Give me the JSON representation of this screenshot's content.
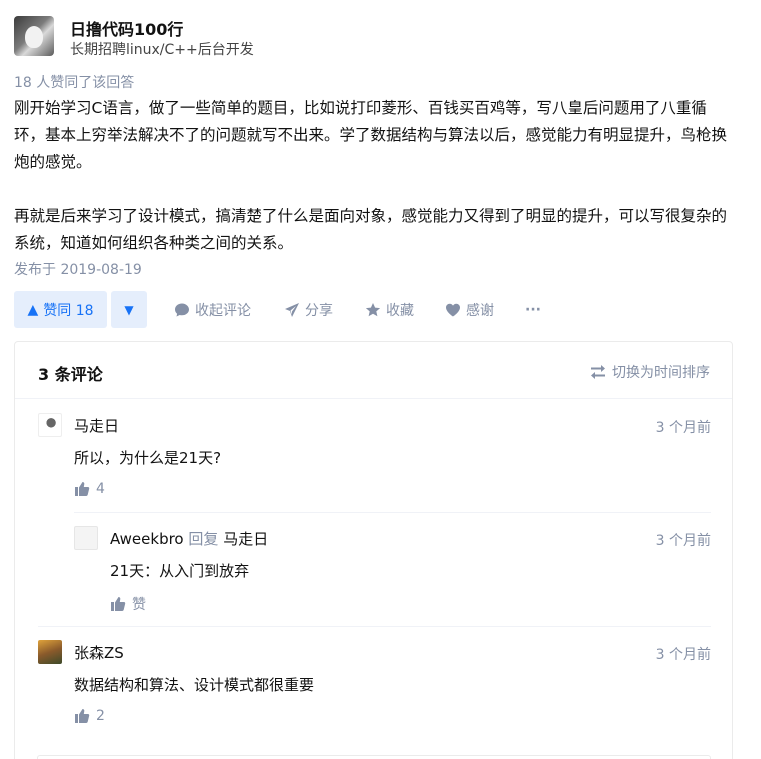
{
  "author": {
    "name": "日撸代码100行",
    "bio": "长期招聘linux/C++后台开发"
  },
  "upvote_info": "18 人赞同了该回答",
  "content": {
    "paragraphs": [
      "刚开始学习C语言，做了一些简单的题目，比如说打印菱形、百钱买百鸡等，写八皇后问题用了八重循环，基本上穷举法解决不了的问题就写不出来。学了数据结构与算法以后，感觉能力有明显提升，鸟枪换炮的感觉。",
      "再就是后来学习了设计模式，搞清楚了什么是面向对象，感觉能力又得到了明显的提升，可以写很复杂的系统，知道如何组织各种类之间的关系。"
    ]
  },
  "pub_date": "发布于 2019-08-19",
  "actions": {
    "vote_up_label": "赞同 18",
    "collapse_comments": "收起评论",
    "share": "分享",
    "favorite": "收藏",
    "thanks": "感谢",
    "more": "···"
  },
  "comments": {
    "count_label": "3 条评论",
    "sort_toggle": "切换为时间排序",
    "items": [
      {
        "name": "马走日",
        "time": "3 个月前",
        "text": "所以，为什么是21天?",
        "likes": "4"
      },
      {
        "name": "Aweekbro",
        "reply_word": "回复",
        "reply_to": "马走日",
        "time": "3 个月前",
        "text": "21天：从入门到放弃",
        "likes": "赞"
      },
      {
        "name": "张森ZS",
        "time": "3 个月前",
        "text": "数据结构和算法、设计模式都很重要",
        "likes": "2"
      }
    ]
  },
  "colors": {
    "accent": "#1772f6",
    "accent_bg": "#e5eefc",
    "muted": "#8590a6"
  }
}
